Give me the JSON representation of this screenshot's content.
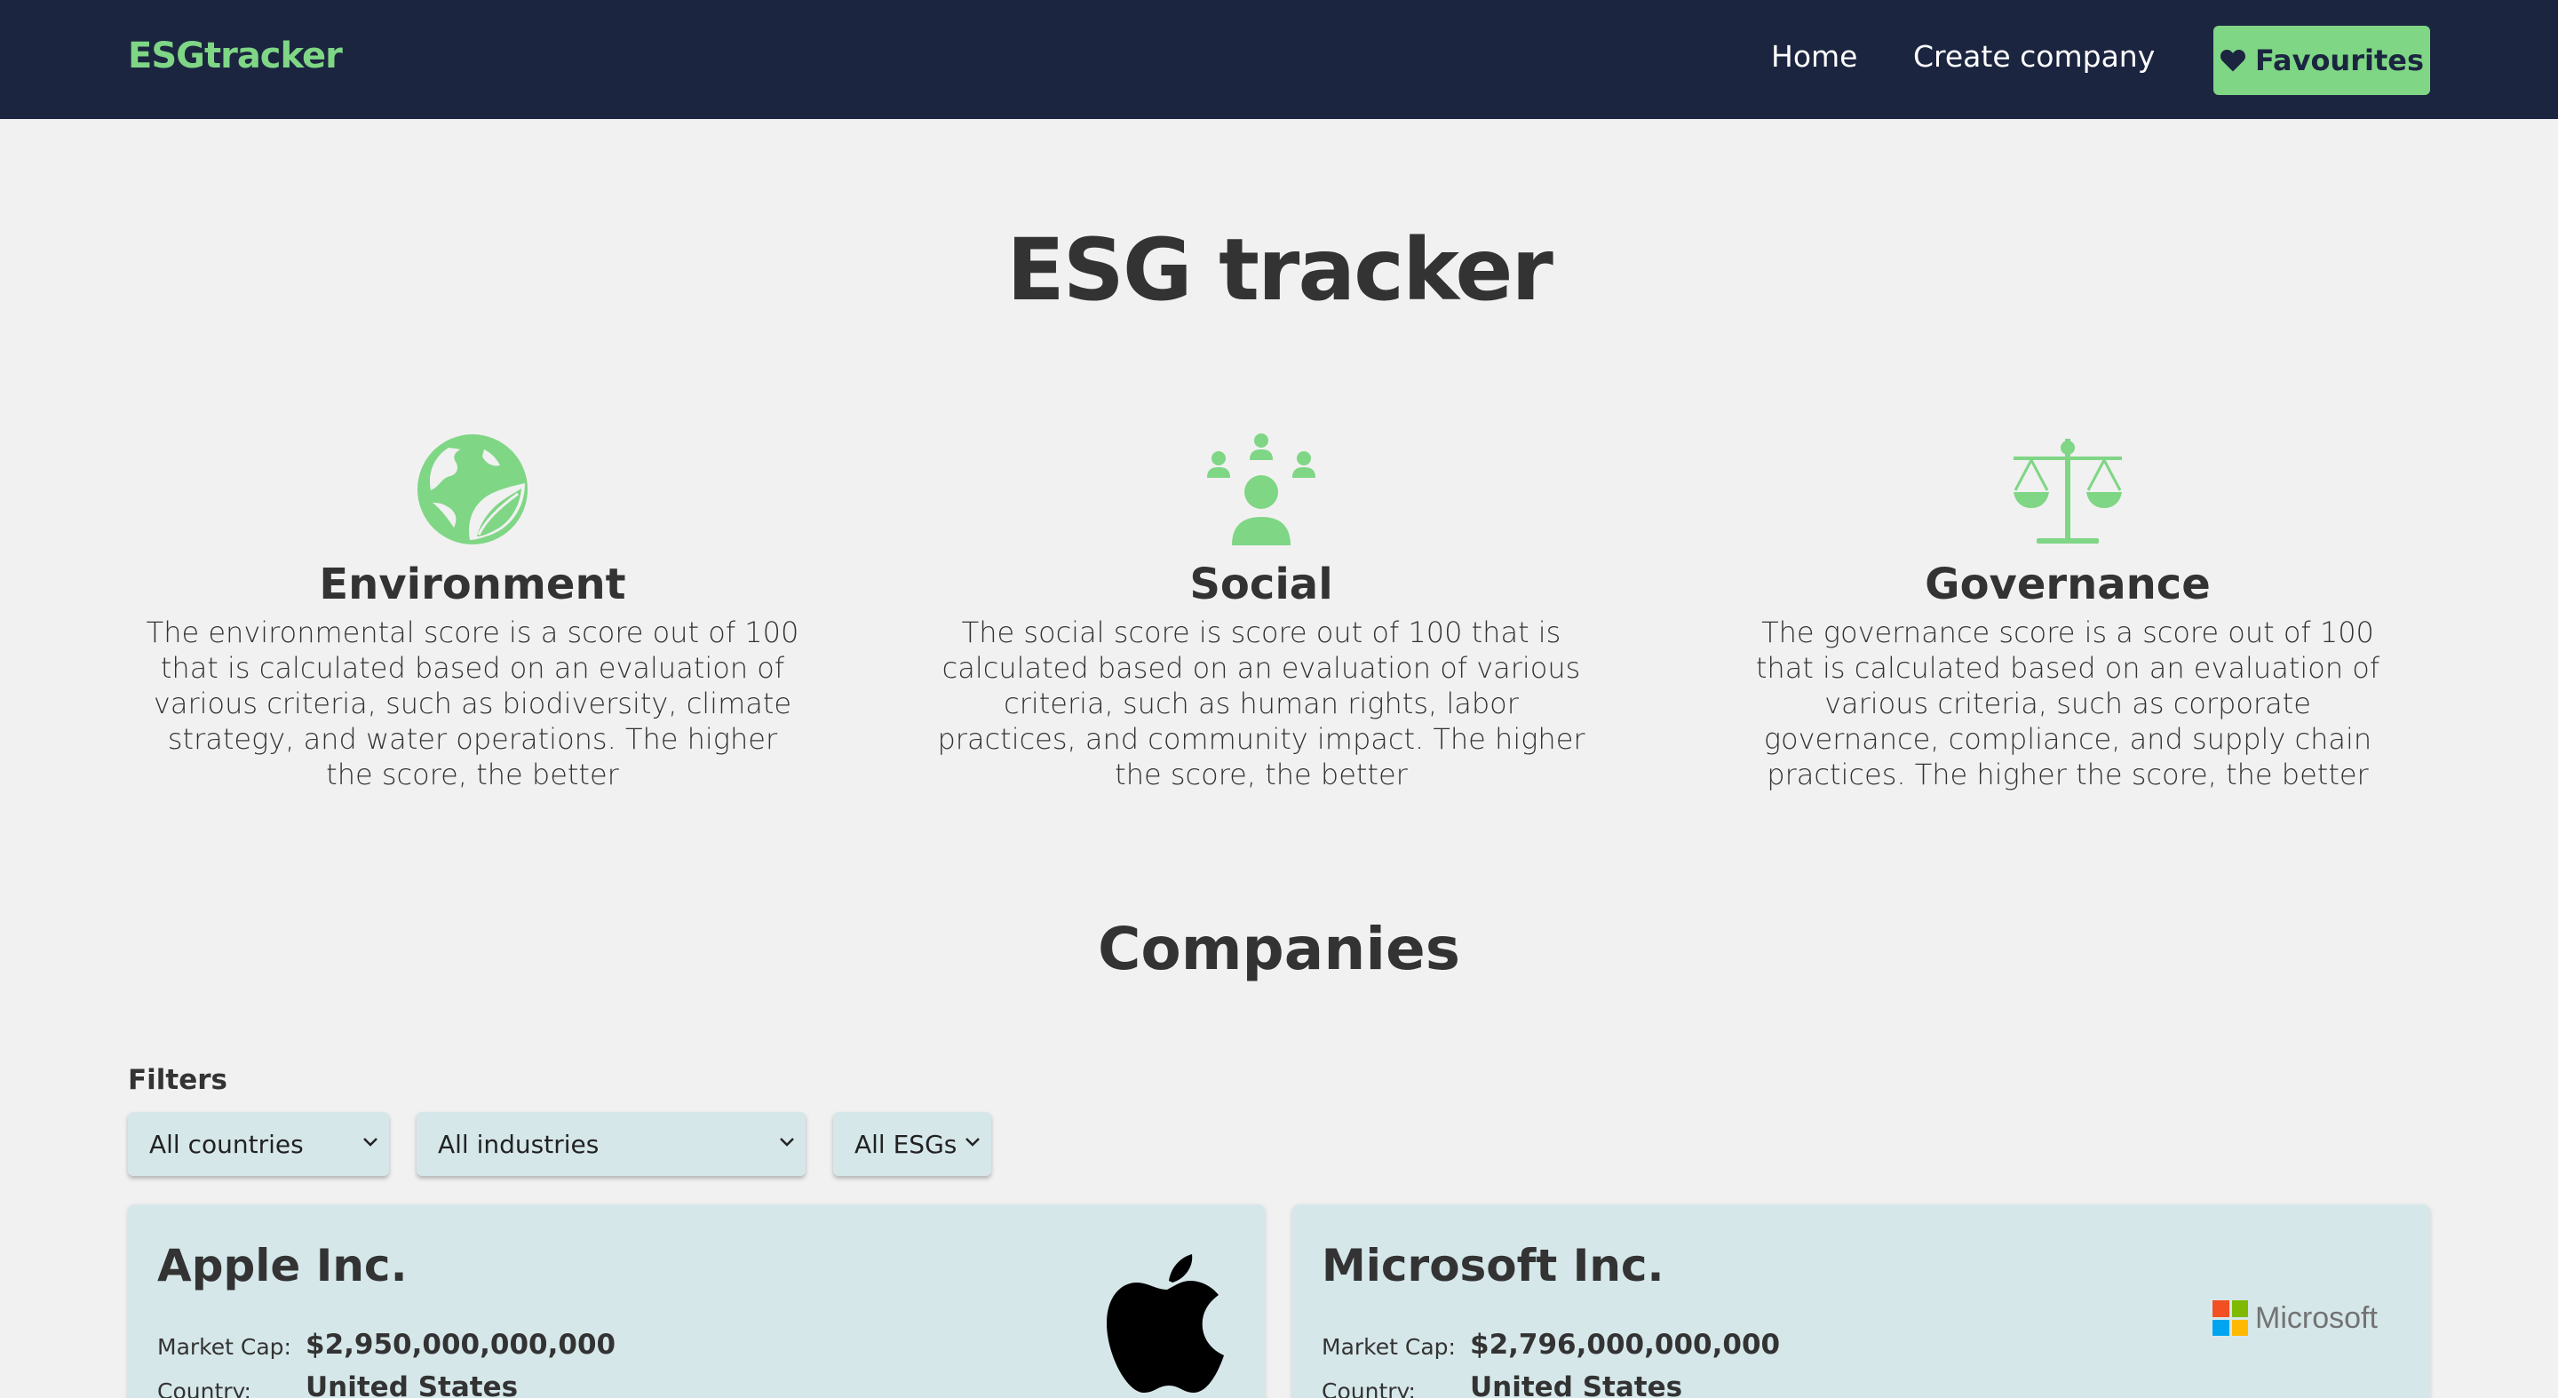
{
  "navbar": {
    "brand": "ESGtracker",
    "links": [
      "Home",
      "Create company"
    ],
    "favourites_label": "Favourites"
  },
  "page": {
    "title": "ESG tracker"
  },
  "pillars": [
    {
      "title": "Environment",
      "icon": "earth-leaf-icon",
      "description": "The environmental score is a score out of 100 that is calculated based on an evaluation of various criteria, such as biodiversity, climate strategy, and water operations. The higher the score, the better"
    },
    {
      "title": "Social",
      "icon": "people-icon",
      "description": "The social score is score out of 100 that is calculated based on an evaluation of various criteria, such as human rights, labor practices, and community impact. The higher the score, the better"
    },
    {
      "title": "Governance",
      "icon": "scales-icon",
      "description": "The governance score is a score out of 100 that is calculated based on an evaluation of various criteria, such as corporate governance, compliance, and supply chain practices. The higher the score, the better"
    }
  ],
  "companies_section": {
    "title": "Companies",
    "filters_label": "Filters",
    "filters": {
      "country": "All countries",
      "industry": "All industries",
      "esg": "All ESGs"
    }
  },
  "companies": [
    {
      "name": "Apple Inc.",
      "market_cap_label": "Market Cap:",
      "market_cap": "$2,950,000,000,000",
      "country_label": "Country:",
      "country": "United States",
      "logo": "apple-logo"
    },
    {
      "name": "Microsoft Inc.",
      "market_cap_label": "Market Cap:",
      "market_cap": "$2,796,000,000,000",
      "country_label": "Country:",
      "country": "United States",
      "logo": "microsoft-logo",
      "logo_text": "Microsoft"
    }
  ],
  "colors": {
    "navbar_bg": "#1b2540",
    "accent_green": "#7fd685",
    "card_bg": "#d6e7ea",
    "page_bg": "#f1f1f1",
    "text": "#333333"
  }
}
